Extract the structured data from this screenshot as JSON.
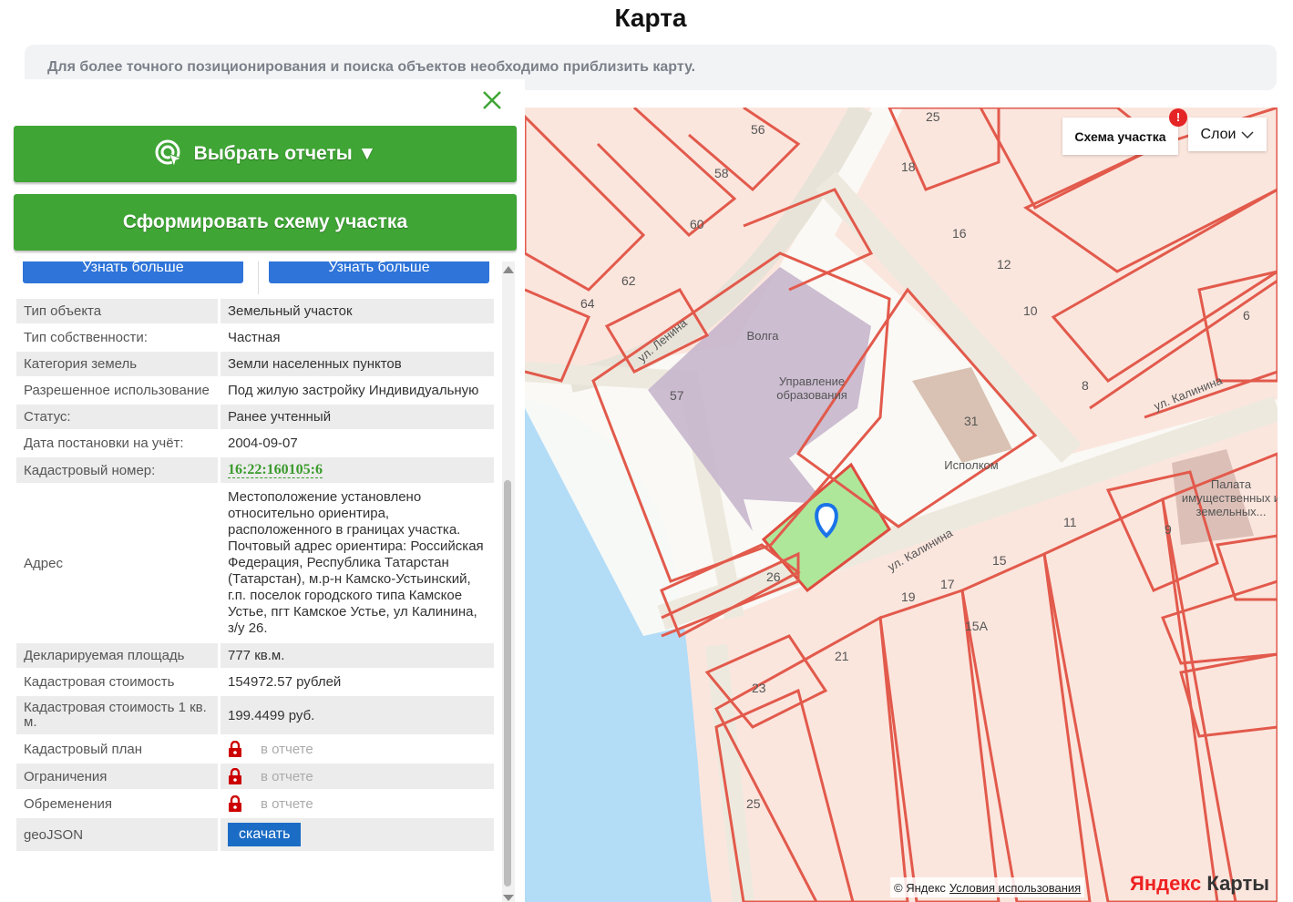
{
  "page": {
    "title": "Карта"
  },
  "notice": "Для более точного позиционирования и поиска объектов необходимо приблизить карту.",
  "panel": {
    "select_reports_label": "Выбрать отчеты ▼",
    "form_scheme_label": "Сформировать схему участка",
    "learn_more_1": "Узнать больше",
    "learn_more_2": "Узнать больше"
  },
  "info": {
    "type_key": "Тип объекта",
    "type_val": "Земельный участок",
    "owner_key": "Тип собственности:",
    "owner_val": "Частная",
    "cat_key": "Категория земель",
    "cat_val": "Земли населенных пунктов",
    "use_key": "Разрешенное использование",
    "use_val": "Под жилую застройку Индивидуальную",
    "status_key": "Статус:",
    "status_val": "Ранее учтенный",
    "date_key": "Дата постановки на учёт:",
    "date_val": "2004-09-07",
    "cad_key": "Кадастровый номер:",
    "cad_val": "16:22:160105:6",
    "addr_key": "Адрес",
    "addr_val": "Местоположение установлено относительно ориентира, расположенного в границах участка. Почтовый адрес ориентира: Российская Федерация, Республика Татарстан (Татарстан), м.р-н Камско-Устьинский, г.п. поселок городского типа Камское Устье, пгт Камское Устье, ул Калинина, з/у 26.",
    "area_key": "Декларируемая площадь",
    "area_val": "777 кв.м.",
    "cost_key": "Кадастровая стоимость",
    "cost_val": "154972.57 рублей",
    "cost1_key": "Кадастровая стоимость 1 кв. м.",
    "cost1_val": "199.4499 руб.",
    "plan_key": "Кадастровый план",
    "plan_val": "в отчете",
    "restr_key": "Ограничения",
    "restr_val": "в отчете",
    "encum_key": "Обременения",
    "encum_val": "в отчете",
    "geo_key": "geoJSON",
    "geo_btn": "скачать"
  },
  "map": {
    "schema_label": "Схема участка",
    "alert": "!",
    "layers_label": "Слои",
    "attribution": "© Яндекс",
    "terms": "Условия использования",
    "logo_a": "Яндекс",
    "logo_b": " Карты",
    "streets": {
      "lenina": "ул. Ленина",
      "kalinina1": "ул. Калинина",
      "kalinina2": "ул. Калинина"
    },
    "pois": {
      "volga": "Волга",
      "uprav": "Управление образования",
      "ispolkom": "Исполком",
      "palata": "Палата имущественных и земельных..."
    },
    "numbers": [
      "56",
      "58",
      "60",
      "62",
      "64",
      "57",
      "25",
      "18",
      "16",
      "12",
      "10",
      "6",
      "8",
      "31",
      "9",
      "11",
      "15",
      "17",
      "19",
      "15А",
      "21",
      "23",
      "26",
      "25"
    ]
  }
}
